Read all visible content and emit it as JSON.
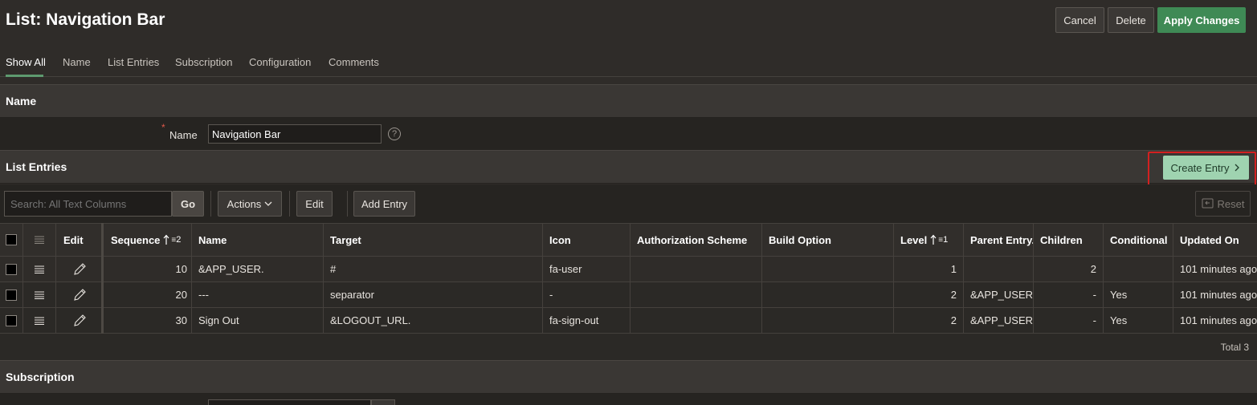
{
  "header": {
    "title": "List: Navigation Bar",
    "cancel_label": "Cancel",
    "delete_label": "Delete",
    "apply_label": "Apply Changes"
  },
  "tabs": [
    "Show All",
    "Name",
    "List Entries",
    "Subscription",
    "Configuration",
    "Comments"
  ],
  "name_section": {
    "title": "Name",
    "field_label": "Name",
    "required_mark": "*",
    "field_value": "Navigation Bar",
    "help_glyph": "?"
  },
  "list_entries": {
    "title": "List Entries",
    "create_entry_label": "Create Entry",
    "search_placeholder": "Search: All Text Columns",
    "go_label": "Go",
    "actions_label": "Actions",
    "edit_label": "Edit",
    "add_entry_label": "Add Entry",
    "reset_label": "Reset",
    "columns": [
      "Edit",
      "Sequence",
      "Name",
      "Target",
      "Icon",
      "Authorization Scheme",
      "Build Option",
      "Level",
      "Parent Entry..",
      "Children",
      "Conditional",
      "Updated On"
    ],
    "sort_badges": {
      "sequence": "2",
      "level": "1"
    },
    "rows": [
      {
        "sequence": "10",
        "name": "&APP_USER.",
        "target": "#",
        "icon": "fa-user",
        "auth": "",
        "build": "",
        "level": "1",
        "parent": "",
        "children": "2",
        "conditional": "",
        "updated": "101 minutes ago"
      },
      {
        "sequence": "20",
        "name": "---",
        "target": "separator",
        "icon": "-",
        "auth": "",
        "build": "",
        "level": "2",
        "parent": "&APP_USER.",
        "children": "-",
        "conditional": "Yes",
        "updated": "101 minutes ago"
      },
      {
        "sequence": "30",
        "name": "Sign Out",
        "target": "&LOGOUT_URL.",
        "icon": "fa-sign-out",
        "auth": "",
        "build": "",
        "level": "2",
        "parent": "&APP_USER.",
        "children": "-",
        "conditional": "Yes",
        "updated": "101 minutes ago"
      }
    ],
    "total": "Total 3"
  },
  "subscription": {
    "title": "Subscription"
  },
  "colors": {
    "primary": "#3f8a55",
    "create_entry": "#9fd3b0",
    "highlight": "#d32020"
  }
}
